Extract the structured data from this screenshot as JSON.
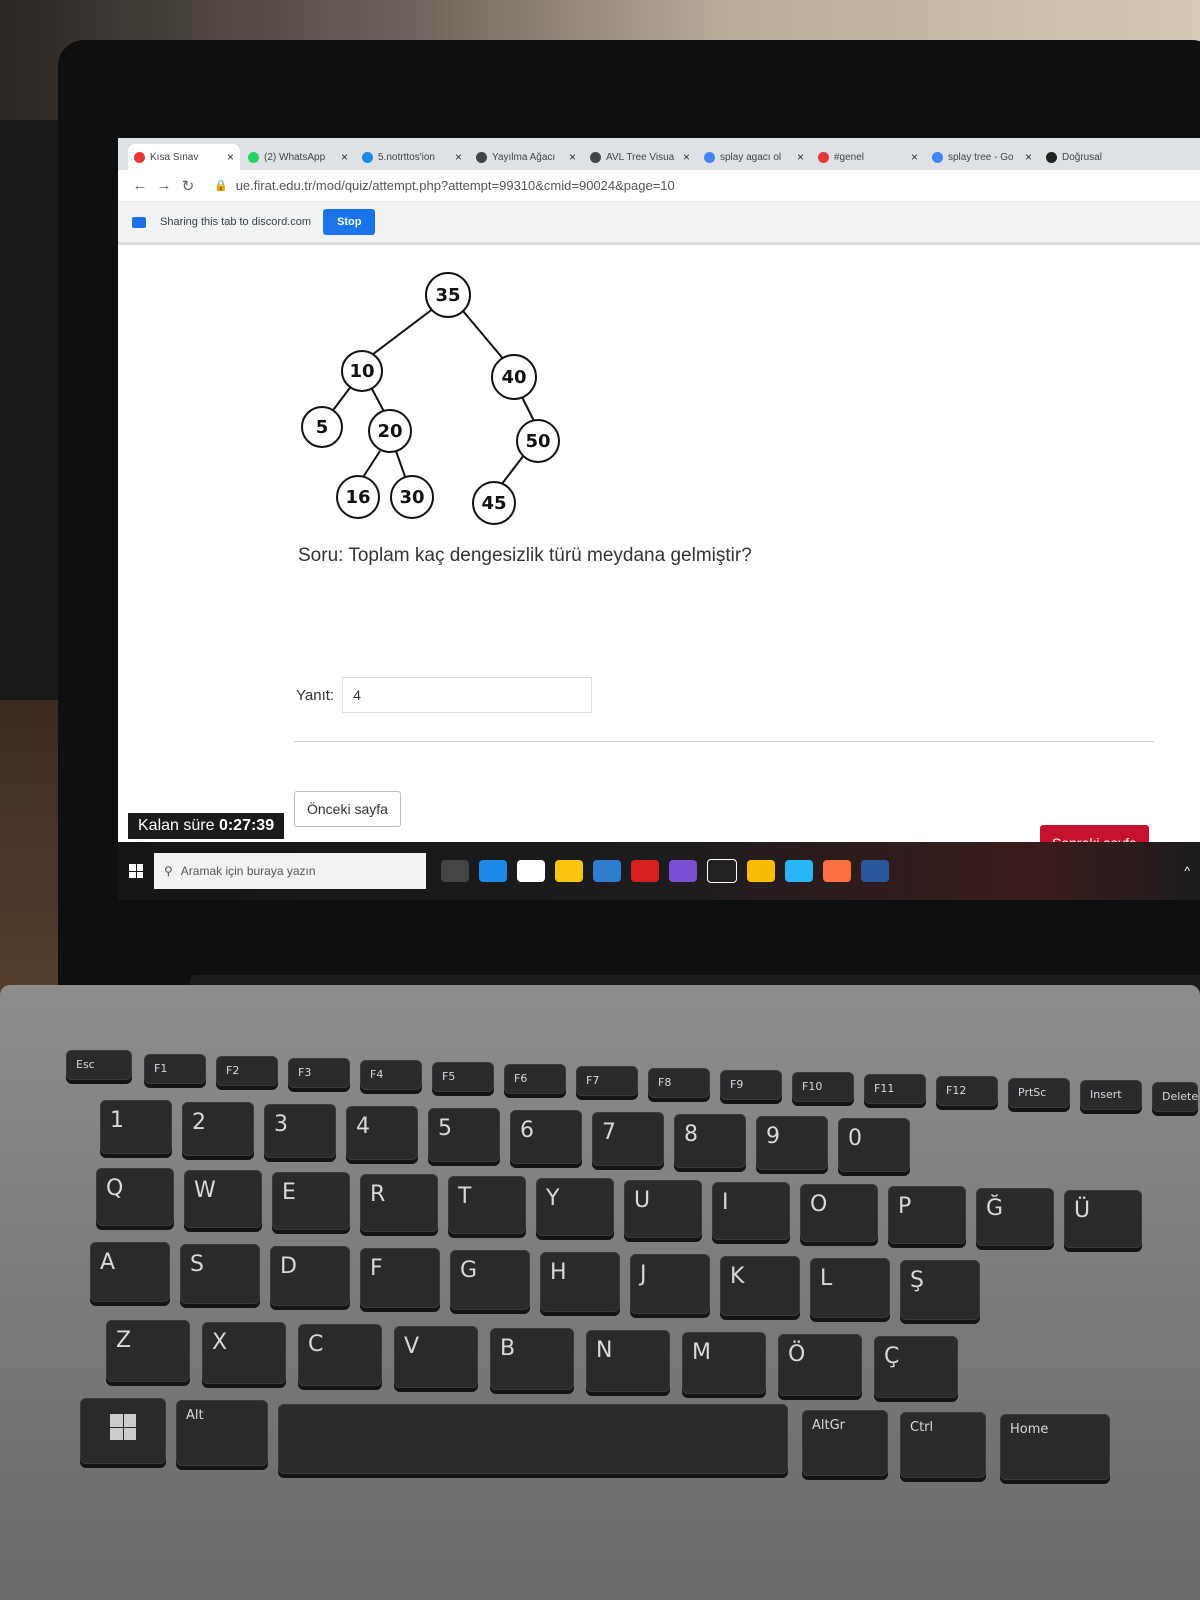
{
  "browser": {
    "tabs": [
      {
        "title": "Kısa Sınav",
        "favicon_color": "#e53935",
        "active": true
      },
      {
        "title": "(2) WhatsApp",
        "favicon_color": "#25d366"
      },
      {
        "title": "5.notrttos'ion",
        "favicon_color": "#1e88e5"
      },
      {
        "title": "Yayılma Ağacı",
        "favicon_color": "#444444"
      },
      {
        "title": "AVL Tree Visua",
        "favicon_color": "#444444"
      },
      {
        "title": "splay agacı ol",
        "favicon_color": "#4285f4"
      },
      {
        "title": "#genel",
        "favicon_color": "#e53935"
      },
      {
        "title": "splay tree - Go",
        "favicon_color": "#4285f4"
      },
      {
        "title": "Doğrusal",
        "favicon_color": "#222222"
      }
    ],
    "url": "ue.firat.edu.tr/mod/quiz/attempt.php?attempt=99310&cmid=90024&page=10",
    "share_banner": {
      "text": "Sharing this tab to discord.com",
      "stop_label": "Stop"
    }
  },
  "quiz": {
    "tree_nodes": [
      {
        "label": "35"
      },
      {
        "label": "10"
      },
      {
        "label": "40"
      },
      {
        "label": "5"
      },
      {
        "label": "20"
      },
      {
        "label": "50"
      },
      {
        "label": "16"
      },
      {
        "label": "30"
      },
      {
        "label": "45"
      }
    ],
    "question": "Soru: Toplam kaç dengesizlik türü meydana gelmiştir?",
    "answer_label": "Yanıt:",
    "answer_value": "4",
    "prev_label": "Önceki sayfa",
    "next_label": "Sonraki sayfa",
    "timer_label": "Kalan süre",
    "timer_value": "0:27:39",
    "accent_color": "#c4122f"
  },
  "taskbar": {
    "search_placeholder": "Aramak için buraya yazın"
  },
  "keyboard": {
    "fn_row": [
      "Esc",
      "F1",
      "F2",
      "F3",
      "F4",
      "F5",
      "F6",
      "F7",
      "F8",
      "F9",
      "F10",
      "F11",
      "F12",
      "PrtSc",
      "Insert",
      "Delete"
    ],
    "row1": [
      "1",
      "2",
      "3",
      "4",
      "5",
      "6",
      "7",
      "8",
      "9",
      "0"
    ],
    "row2": [
      "Q",
      "W",
      "E",
      "R",
      "T",
      "Y",
      "U",
      "I",
      "O",
      "P",
      "Ğ",
      "Ü"
    ],
    "row3": [
      "A",
      "S",
      "D",
      "F",
      "G",
      "H",
      "J",
      "K",
      "L",
      "Ş"
    ],
    "row4": [
      "Z",
      "X",
      "C",
      "V",
      "B",
      "N",
      "M",
      "Ö",
      "Ç"
    ],
    "bottom": [
      "Alt",
      "AltGr",
      "Ctrl",
      "Home"
    ]
  }
}
